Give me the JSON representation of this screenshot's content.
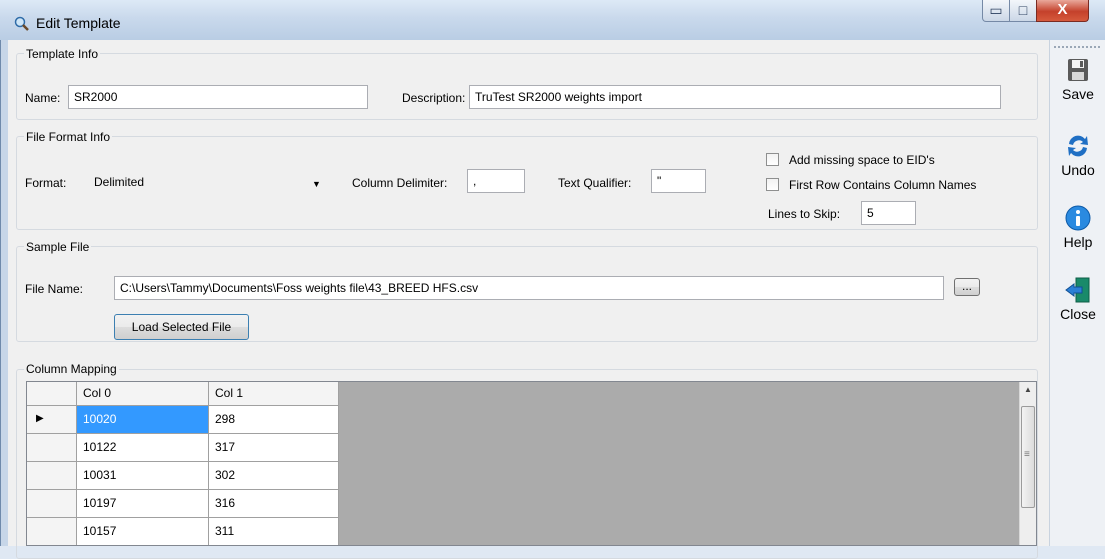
{
  "window": {
    "title": "Edit Template",
    "min_glyph": "▭",
    "max_glyph": "□",
    "close_glyph": "X"
  },
  "toolbar": {
    "save_label": "Save",
    "undo_label": "Undo",
    "help_label": "Help",
    "close_label": "Close"
  },
  "template_info": {
    "group_title": "Template Info",
    "name_label": "Name:",
    "name_value": "SR2000",
    "description_label": "Description:",
    "description_value": "TruTest SR2000 weights import"
  },
  "file_format": {
    "group_title": "File Format Info",
    "format_label": "Format:",
    "format_value": "Delimited",
    "column_delimiter_label": "Column Delimiter:",
    "column_delimiter_value": ",",
    "text_qualifier_label": "Text Qualifier:",
    "text_qualifier_value": "\"",
    "add_missing_space_label": "Add missing space to EID's",
    "add_missing_space_checked": false,
    "first_row_label": "First Row Contains Column Names",
    "first_row_checked": false,
    "lines_to_skip_label": "Lines to Skip:",
    "lines_to_skip_value": "5"
  },
  "sample_file": {
    "group_title": "Sample File",
    "file_name_label": "File Name:",
    "file_name_value": "C:\\Users\\Tammy\\Documents\\Foss weights file\\43_BREED HFS.csv",
    "browse_label": "...",
    "load_button_label": "Load Selected File"
  },
  "column_mapping": {
    "group_title": "Column Mapping",
    "row_indicator": "▶",
    "scroll_up": "▲",
    "scroll_grip": "≡",
    "columns": [
      "Col 0",
      "Col 1"
    ],
    "rows": [
      [
        "10020",
        "298"
      ],
      [
        "10122",
        "317"
      ],
      [
        "10031",
        "302"
      ],
      [
        "10197",
        "316"
      ],
      [
        "10157",
        "311"
      ]
    ]
  },
  "colors": {
    "selection": "#3399ff",
    "button_border": "#3c7fb1",
    "grid_background": "#ababab"
  }
}
